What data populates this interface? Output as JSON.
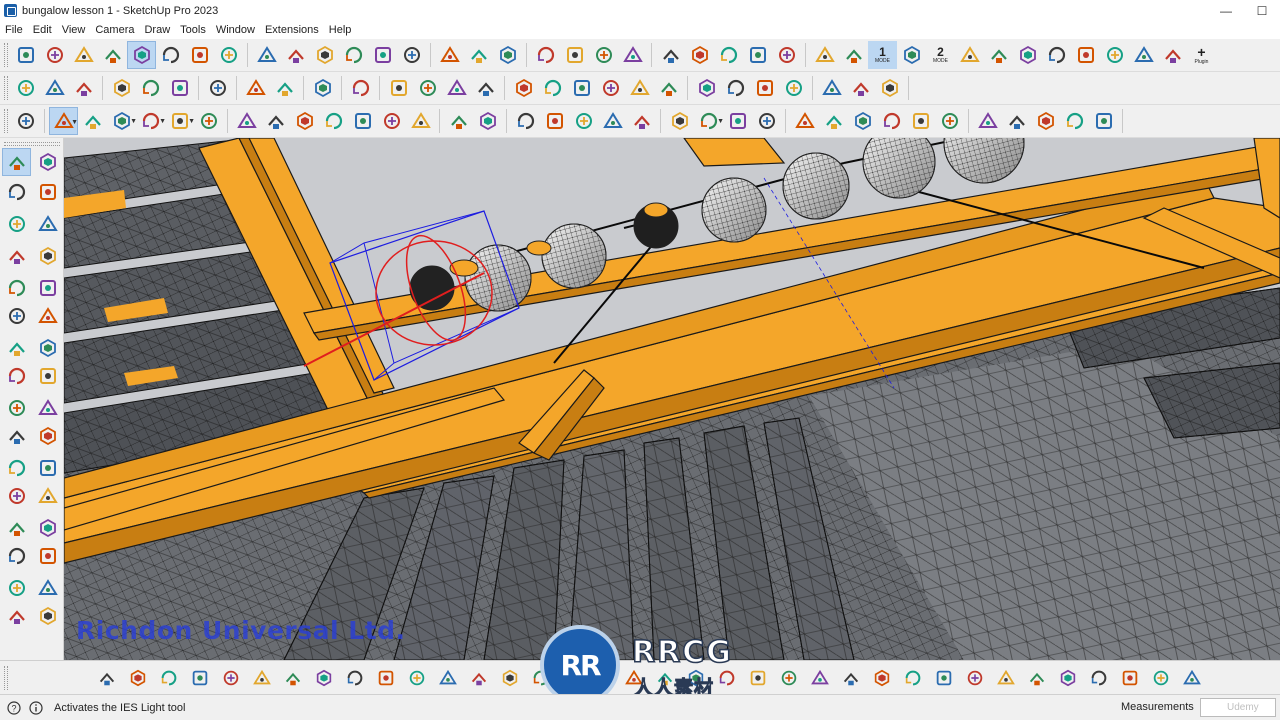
{
  "window": {
    "title": "bungalow lesson 1 - SketchUp Pro 2023",
    "minimize_glyph": "—",
    "maximize_glyph": "☐"
  },
  "menu": [
    "File",
    "Edit",
    "View",
    "Camera",
    "Draw",
    "Tools",
    "Window",
    "Extensions",
    "Help"
  ],
  "toolbar_row1": {
    "icons": [
      "light-gear-icon",
      "spot-light-icon",
      "ring-light-icon",
      "cone-light-icon",
      "ies-light-icon",
      "star-light-icon",
      "dome-light-icon",
      "sphere-light-icon",
      "camera-tripod-icon",
      "box-icon",
      "box-open-icon",
      "grass-icon",
      "leaf-icon",
      "frame-icon",
      "check-box-icon",
      "grid-icon",
      "stack-icon",
      "share-icon",
      "shapes-icon",
      "shapes-alt-icon",
      "pattern-icon",
      "cube-outline-icon",
      "cube-solid-icon",
      "sphere-mesh-icon",
      "ball-icon",
      "layers-icon",
      "chart-red-icon",
      "sliders-icon"
    ],
    "mode1": {
      "num": "1",
      "label": "MODE"
    },
    "mode2": {
      "num": "2",
      "label": "MODE"
    },
    "plugin": {
      "label": "Plugin"
    }
  },
  "toolbar_row2": {
    "icons": [
      "add-circle-icon",
      "open-folder-icon",
      "save-icon",
      "cut-icon",
      "copy-icon",
      "paste-icon",
      "erase-icon",
      "undo-icon",
      "redo-icon",
      "print-icon",
      "info-icon",
      "component-a-icon",
      "component-b-icon",
      "component-c-icon",
      "component-d-icon",
      "iso-view-icon",
      "top-view-icon",
      "front-view-icon",
      "right-view-icon",
      "back-view-icon",
      "left-view-icon",
      "tree-icon",
      "grass-small-icon",
      "bush-icon",
      "shrub-icon",
      "wire-cube-icon",
      "solid-cube-icon",
      "textured-cube-icon"
    ]
  },
  "toolbar_row3": {
    "icons": [
      "zoom-icon",
      "select-icon",
      "eraser-icon",
      "pencil-icon",
      "shape-icon",
      "fill-icon",
      "push-pull-icon",
      "follow-me-icon",
      "move-icon",
      "rotate-icon",
      "scale-icon",
      "offset-icon",
      "tape-icon",
      "paint-icon",
      "orbit-icon",
      "pan-icon",
      "zoom-window-icon",
      "zoom-extents-icon",
      "section-a-icon",
      "section-b-icon",
      "section-c-icon",
      "section-d-icon",
      "section-e-icon",
      "styles-icon",
      "materials-icon",
      "shadow-icon",
      "fog-icon",
      "house-a-icon",
      "house-b-icon",
      "house-c-icon",
      "terrain-icon",
      "stairs-icon",
      "window-a-icon",
      "window-b-icon",
      "window-c-icon",
      "lock-icon"
    ]
  },
  "left_toolbar": {
    "icons": [
      "select-tool-icon",
      "orbit-tool-icon",
      "paint-tool-icon",
      "eraser-tool-icon",
      "component-tool-icon",
      "tag-tool-icon",
      "line-tool-icon",
      "freehand-tool-icon",
      "rectangle-tool-icon",
      "rotated-rect-tool-icon",
      "circle-tool-icon",
      "polygon-tool-icon",
      "arc-tool-icon",
      "two-point-arc-tool-icon",
      "three-point-arc-tool-icon",
      "pie-tool-icon",
      "move-tool-icon",
      "push-pull-tool-icon",
      "rotate-tool-icon",
      "follow-me-tool-icon",
      "scale-tool-icon",
      "offset-tool-icon",
      "axes-tool-icon",
      "position-camera-icon",
      "tape-measure-tool-icon",
      "dimension-tool-icon",
      "protractor-tool-icon",
      "text-tool-icon",
      "axes-small-icon",
      "3d-text-tool-icon",
      "orbit-small-icon",
      "hand-tool-icon"
    ]
  },
  "bottom_toolbar": {
    "icons": [
      "bt-1-icon",
      "bt-2-icon",
      "bt-3-icon",
      "bt-4-icon",
      "bt-5-icon",
      "bt-6-icon",
      "bt-7-icon",
      "bt-8-icon",
      "bt-9-icon",
      "bt-10-icon",
      "bt-11-icon",
      "bt-12-icon",
      "bt-13-icon",
      "bt-14-icon",
      "bt-15-icon",
      "bt-16-icon",
      "bt-17-icon",
      "bt-18-icon",
      "bt-19-icon",
      "bt-20-icon",
      "bt-21-icon",
      "bt-22-icon",
      "bt-23-icon",
      "bt-24-icon",
      "bt-25-icon",
      "bt-26-icon",
      "bt-27-icon",
      "bt-28-icon",
      "bt-29-icon",
      "bt-30-icon",
      "bt-31-icon",
      "bt-32-icon",
      "bt-33-icon",
      "bt-34-icon",
      "bt-35-icon",
      "bt-36-icon"
    ]
  },
  "viewport": {
    "watermark": "Richdon Universal Ltd.",
    "colors": {
      "beam": "#f4a62a",
      "beam_dark": "#c87e12",
      "sky": "#c9cbcf",
      "panel": "#55585c",
      "selection": "#1d1de0",
      "gizmo": "#e01e1e"
    }
  },
  "logo": {
    "mark": "RR",
    "word": "RRCG",
    "sub": "人人素材"
  },
  "status": {
    "message": "Activates the IES Light tool",
    "measurements_label": "Measurements",
    "measurements_value": "Udemy"
  }
}
